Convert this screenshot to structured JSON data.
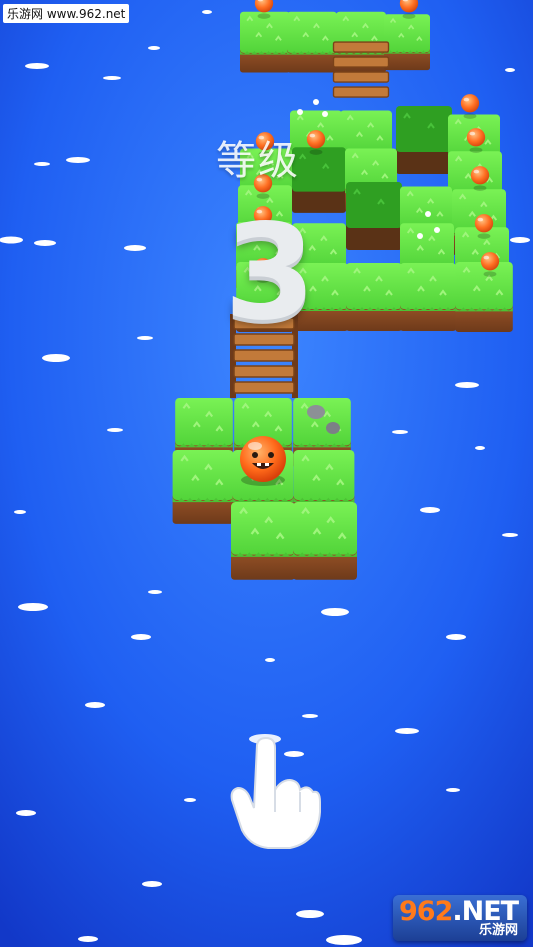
{
  "watermark_top": "乐游网 www.962.net",
  "level": {
    "label": "等级",
    "number": "3"
  },
  "logo": {
    "digits": "962",
    "net": ".NET",
    "subtitle": "乐游网"
  },
  "colors": {
    "water": "#1c5ff0",
    "grass": "#5ee043",
    "dirt": "#8a4a22",
    "bridge": "#b06a30",
    "ball": "#ff6a1a"
  },
  "icons": {
    "tutorial_hand": "pointing-hand-icon",
    "player": "orange-ball-character"
  }
}
